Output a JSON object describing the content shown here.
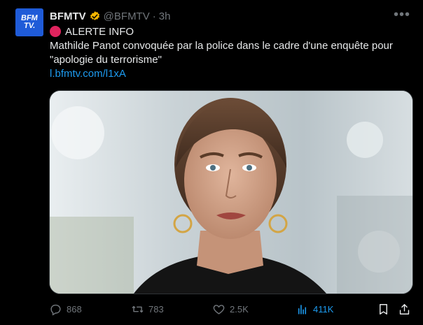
{
  "tweet": {
    "author_name": "BFMTV",
    "handle": "@BFMTV",
    "separator": "·",
    "time": "3h",
    "avatar_line1": "BFM",
    "avatar_line2": "TV.",
    "alert_text": "ALERTE INFO",
    "body_line1": "Mathilde Panot convoquée par la police dans le cadre d'une enquête pour",
    "body_line2": "\"apologie du terrorisme\"",
    "link": "l.bfmtv.com/l1xA",
    "more_label": "•••"
  },
  "actions": {
    "replies": "868",
    "reposts": "783",
    "likes": "2.5K",
    "views": "411K"
  },
  "icons": {
    "verified": "verified-badge-icon",
    "alert": "red-circle-icon",
    "reply": "reply-icon",
    "repost": "repost-icon",
    "like": "heart-icon",
    "views": "views-bar-chart-icon",
    "bookmark": "bookmark-icon",
    "share": "share-icon"
  },
  "colors": {
    "background": "#000000",
    "text": "#e7e9ea",
    "muted": "#71767b",
    "link": "#1d9bf0",
    "verified": "#f4b500",
    "brand": "#1f5bd8",
    "alert": "#e0245e"
  }
}
